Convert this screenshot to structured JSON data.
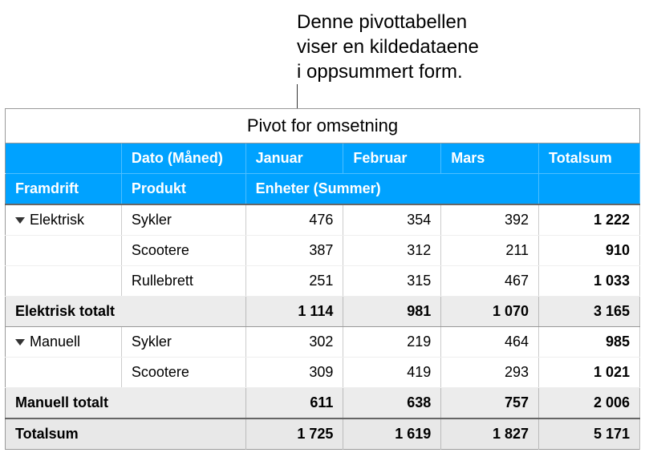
{
  "annotation": {
    "line1": "Denne pivottabellen",
    "line2": "viser en kildedataene",
    "line3": "i oppsummert form."
  },
  "table": {
    "title": "Pivot for omsetning",
    "headers": {
      "dato": "Dato (Måned)",
      "januar": "Januar",
      "februar": "Februar",
      "mars": "Mars",
      "totalsum": "Totalsum",
      "framdrift": "Framdrift",
      "produkt": "Produkt",
      "enheter": "Enheter (Summer)"
    },
    "groups": [
      {
        "name": "Elektrisk",
        "rows": [
          {
            "produkt": "Sykler",
            "januar": "476",
            "februar": "354",
            "mars": "392",
            "total": "1 222"
          },
          {
            "produkt": "Scootere",
            "januar": "387",
            "februar": "312",
            "mars": "211",
            "total": "910"
          },
          {
            "produkt": "Rullebrett",
            "januar": "251",
            "februar": "315",
            "mars": "467",
            "total": "1 033"
          }
        ],
        "subtotal": {
          "label": "Elektrisk totalt",
          "januar": "1 114",
          "februar": "981",
          "mars": "1 070",
          "total": "3 165"
        }
      },
      {
        "name": "Manuell",
        "rows": [
          {
            "produkt": "Sykler",
            "januar": "302",
            "februar": "219",
            "mars": "464",
            "total": "985"
          },
          {
            "produkt": "Scootere",
            "januar": "309",
            "februar": "419",
            "mars": "293",
            "total": "1 021"
          }
        ],
        "subtotal": {
          "label": "Manuell totalt",
          "januar": "611",
          "februar": "638",
          "mars": "757",
          "total": "2 006"
        }
      }
    ],
    "grandtotal": {
      "label": "Totalsum",
      "januar": "1 725",
      "februar": "1 619",
      "mars": "1 827",
      "total": "5 171"
    }
  }
}
